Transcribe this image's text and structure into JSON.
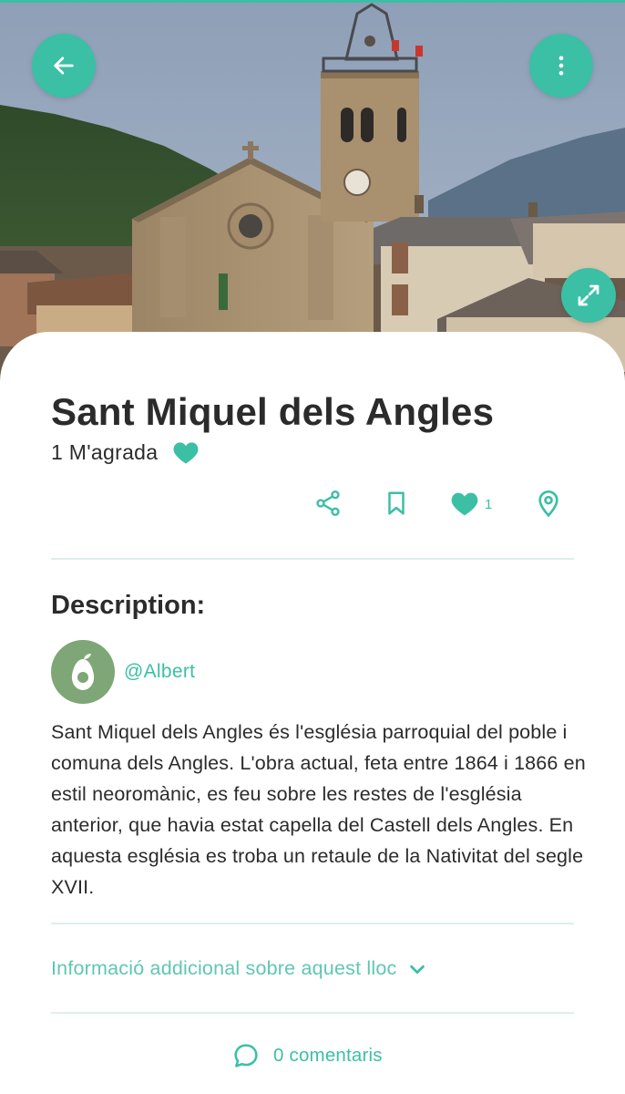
{
  "place": {
    "title": "Sant Miquel dels Angles",
    "likes_label": "1 M'agrada",
    "photo_description": ""
  },
  "actions": {
    "like_count": "1"
  },
  "description": {
    "heading": "Description:",
    "author": "@Albert",
    "body": "Sant Miquel dels Angles és l'església parroquial del poble i comuna dels Angles. L'obra actual, feta entre 1864 i 1866 en estil neoromànic, es feu sobre les restes de l'església anterior, que havia estat capella del Castell dels Angles. En aquesta església es troba un retaule de la Nativitat del segle XVII."
  },
  "additional_info": {
    "label": "Informació addicional sobre aquest lloc"
  },
  "comments": {
    "label": "0 comentaris"
  },
  "icons": {
    "back": "arrow-left-icon",
    "menu": "more-vertical-icon",
    "expand": "expand-icon",
    "share": "share-icon",
    "bookmark": "bookmark-icon",
    "like": "heart-icon",
    "location": "map-pin-icon",
    "chevron": "chevron-down-icon",
    "comment": "comment-icon"
  },
  "colors": {
    "accent": "#3bbfa5",
    "text": "#2b2b2b",
    "divider": "#dcefed",
    "avatar_bg": "#7ea676"
  }
}
